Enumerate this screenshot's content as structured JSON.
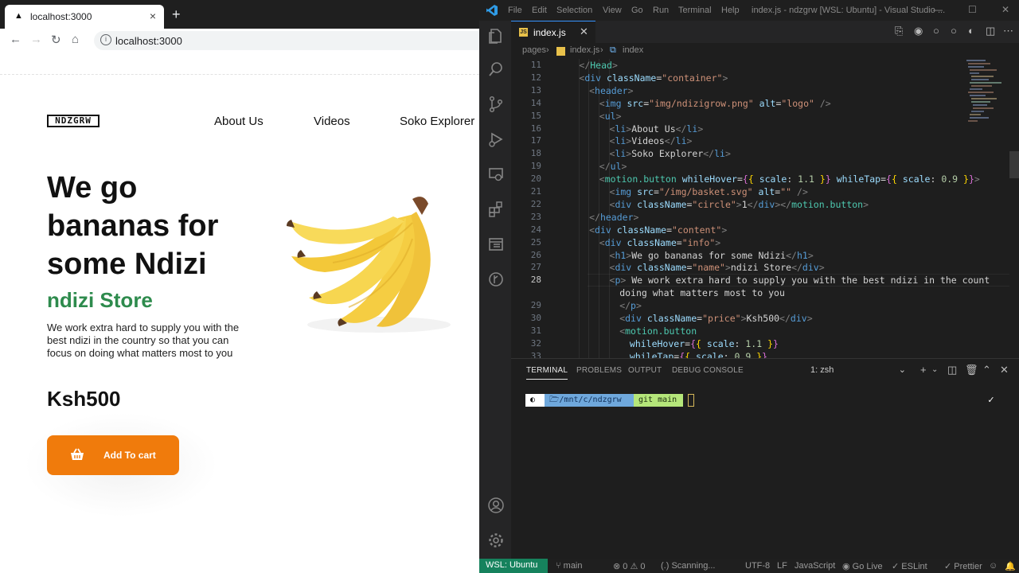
{
  "browser": {
    "tab_title": "localhost:3000",
    "tab_favicon": "triangle-favicon",
    "url": "localhost:3000",
    "page": {
      "logo": "NDZGRW",
      "nav": [
        "About Us",
        "Videos",
        "Soko Explorer"
      ],
      "hero_title": "We go bananas for some Ndizi",
      "store_name": "ndizi Store",
      "description": "We work extra hard to supply you with the best ndizi in the country so that you can focus on doing what matters most to you",
      "price": "Ksh500",
      "cart_button": "Add To cart"
    },
    "colors": {
      "accent_orange": "#f07b0c",
      "store_green": "#2e8b4d"
    }
  },
  "vscode": {
    "menu": [
      "File",
      "Edit",
      "Selection",
      "View",
      "Go",
      "Run",
      "Terminal",
      "Help"
    ],
    "window_title": "index.js - ndzgrw [WSL: Ubuntu] - Visual Studio ...",
    "tab": {
      "name": "index.js",
      "badge": "JS"
    },
    "breadcrumb": [
      "pages",
      "index.js",
      "index"
    ],
    "code_lines": [
      {
        "n": "11",
        "indent": 2,
        "html": "<span class='p'>&lt;/</span><span class='k'>Head</span><span class='p'>&gt;</span>"
      },
      {
        "n": "12",
        "indent": 2,
        "html": "<span class='p'>&lt;</span><span class='t'>div</span> <span class='a'>className</span>=<span class='s'>\"container\"</span><span class='p'>&gt;</span>"
      },
      {
        "n": "13",
        "indent": 3,
        "html": "<span class='p'>&lt;</span><span class='t'>header</span><span class='p'>&gt;</span>"
      },
      {
        "n": "14",
        "indent": 4,
        "html": "<span class='p'>&lt;</span><span class='t'>img</span> <span class='a'>src</span>=<span class='s'>\"img/ndizigrow.png\"</span> <span class='a'>alt</span>=<span class='s'>\"logo\"</span> <span class='p'>/&gt;</span>"
      },
      {
        "n": "15",
        "indent": 4,
        "html": "<span class='p'>&lt;</span><span class='t'>ul</span><span class='p'>&gt;</span>"
      },
      {
        "n": "16",
        "indent": 5,
        "html": "<span class='p'>&lt;</span><span class='t'>li</span><span class='p'>&gt;</span>About Us<span class='p'>&lt;/</span><span class='t'>li</span><span class='p'>&gt;</span>"
      },
      {
        "n": "17",
        "indent": 5,
        "html": "<span class='p'>&lt;</span><span class='t'>li</span><span class='p'>&gt;</span>Videos<span class='p'>&lt;/</span><span class='t'>li</span><span class='p'>&gt;</span>"
      },
      {
        "n": "18",
        "indent": 5,
        "html": "<span class='p'>&lt;</span><span class='t'>li</span><span class='p'>&gt;</span>Soko Explorer<span class='p'>&lt;/</span><span class='t'>li</span><span class='p'>&gt;</span>"
      },
      {
        "n": "19",
        "indent": 4,
        "html": "<span class='p'>&lt;/</span><span class='t'>ul</span><span class='p'>&gt;</span>"
      },
      {
        "n": "20",
        "indent": 4,
        "html": "<span class='p'>&lt;</span><span class='k'>motion.button</span> <span class='a'>whileHover</span>=<span class='c2'>{</span><span class='b'>{</span> <span class='a'>scale</span>: <span class='n'>1.1</span> <span class='b'>}</span><span class='c2'>}</span> <span class='a'>whileTap</span>=<span class='c2'>{</span><span class='b'>{</span> <span class='a'>scale</span>: <span class='n'>0.9</span> <span class='b'>}</span><span class='c2'>}</span><span class='p'>&gt;</span>"
      },
      {
        "n": "21",
        "indent": 5,
        "html": "<span class='p'>&lt;</span><span class='t'>img</span> <span class='a'>src</span>=<span class='s'>\"/img/basket.svg\"</span> <span class='a'>alt</span>=<span class='s'>\"\"</span> <span class='p'>/&gt;</span>"
      },
      {
        "n": "22",
        "indent": 5,
        "html": "<span class='p'>&lt;</span><span class='t'>div</span> <span class='a'>className</span>=<span class='s'>\"circle\"</span><span class='p'>&gt;</span>1<span class='p'>&lt;/</span><span class='t'>div</span><span class='p'>&gt;&lt;/</span><span class='k'>motion.button</span><span class='p'>&gt;</span>"
      },
      {
        "n": "23",
        "indent": 3,
        "html": "<span class='p'>&lt;/</span><span class='t'>header</span><span class='p'>&gt;</span>"
      },
      {
        "n": "24",
        "indent": 3,
        "html": "<span class='p'>&lt;</span><span class='t'>div</span> <span class='a'>className</span>=<span class='s'>\"content\"</span><span class='p'>&gt;</span>"
      },
      {
        "n": "25",
        "indent": 4,
        "html": "<span class='p'>&lt;</span><span class='t'>div</span> <span class='a'>className</span>=<span class='s'>\"info\"</span><span class='p'>&gt;</span>"
      },
      {
        "n": "26",
        "indent": 5,
        "html": "<span class='p'>&lt;</span><span class='t'>h1</span><span class='p'>&gt;</span>We go bananas for some Ndizi<span class='p'>&lt;/</span><span class='t'>h1</span><span class='p'>&gt;</span>"
      },
      {
        "n": "27",
        "indent": 5,
        "html": "<span class='p'>&lt;</span><span class='t'>div</span> <span class='a'>className</span>=<span class='s'>\"name\"</span><span class='p'>&gt;</span>ndizi Store<span class='p'>&lt;/</span><span class='t'>div</span><span class='p'>&gt;</span>"
      },
      {
        "n": "28",
        "indent": 5,
        "html": "<span class='p'>&lt;</span><span class='t'>p</span><span class='p'>&gt;</span> We work extra hard to supply you with the best ndizi in the count"
      },
      {
        "n": "",
        "indent": 6,
        "html": "doing what matters most to you"
      },
      {
        "n": "29",
        "indent": 6,
        "html": "<span class='p'>&lt;/</span><span class='t'>p</span><span class='p'>&gt;</span>"
      },
      {
        "n": "30",
        "indent": 6,
        "html": "<span class='p'>&lt;</span><span class='t'>div</span> <span class='a'>className</span>=<span class='s'>\"price\"</span><span class='p'>&gt;</span>Ksh500<span class='p'>&lt;/</span><span class='t'>div</span><span class='p'>&gt;</span>"
      },
      {
        "n": "31",
        "indent": 6,
        "html": "<span class='p'>&lt;</span><span class='k'>motion.button</span>"
      },
      {
        "n": "32",
        "indent": 7,
        "html": "<span class='a'>whileHover</span>=<span class='c2'>{</span><span class='b'>{</span> <span class='a'>scale</span>: <span class='n'>1.1</span> <span class='b'>}</span><span class='c2'>}</span>"
      },
      {
        "n": "33",
        "indent": 7,
        "html": "<span class='a'>whileTap</span>=<span class='c2'>{</span><span class='b'>{</span> <span class='a'>scale</span>: <span class='n'>0.9</span> <span class='b'>}</span><span class='c2'>}</span>"
      }
    ],
    "current_line": "28",
    "panel_tabs": [
      "TERMINAL",
      "PROBLEMS",
      "OUTPUT",
      "DEBUG CONSOLE"
    ],
    "terminal_select": "1: zsh",
    "prompt": {
      "path": "/mnt/c/ndzgrw",
      "branch": "main"
    },
    "status": {
      "remote": "WSL: Ubuntu",
      "branch": "main",
      "problems": "0 ⚠ 0",
      "scanning": "(.) Scanning...",
      "encoding": "UTF-8",
      "eol": "LF",
      "language": "JavaScript",
      "golive": "Go Live",
      "eslint": "ESLint",
      "prettier": "Prettier"
    },
    "colors": {
      "status_remote": "#16825d",
      "prompt_path": "#6fa8dc",
      "prompt_branch": "#b5e67a"
    }
  }
}
